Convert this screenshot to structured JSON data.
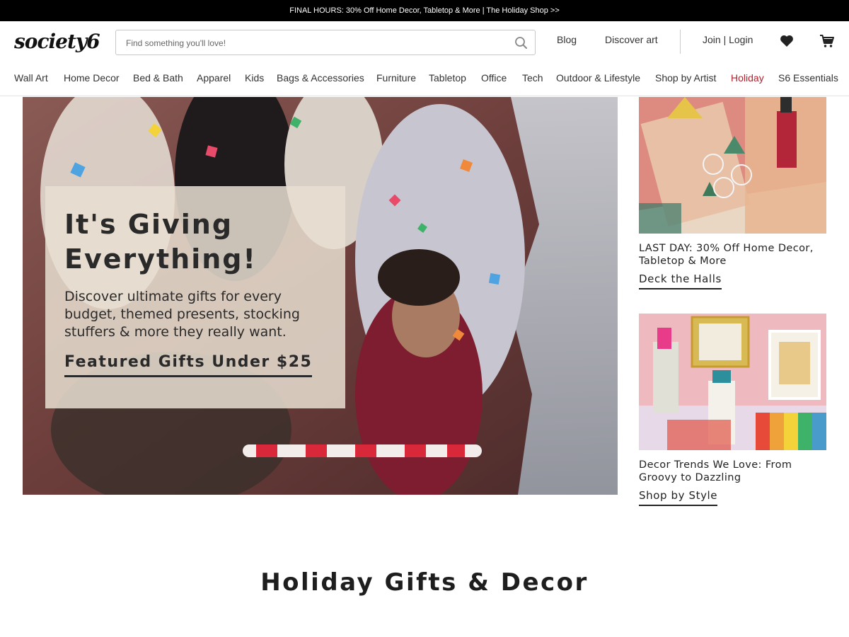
{
  "promo_bar": {
    "text": "FINAL HOURS: 30% Off Home Decor, Tabletop & More | The Holiday Shop >>"
  },
  "header": {
    "logo": "society6",
    "search": {
      "placeholder": "Find something you'll love!",
      "value": ""
    },
    "blog_label": "Blog",
    "discover_label": "Discover art",
    "join_login_label": "Join | Login",
    "icons": [
      "search-icon",
      "heart-icon",
      "cart-icon"
    ]
  },
  "nav": {
    "items": [
      {
        "label": "Wall Art"
      },
      {
        "label": "Home Decor"
      },
      {
        "label": "Bed & Bath"
      },
      {
        "label": "Apparel"
      },
      {
        "label": "Kids"
      },
      {
        "label": "Bags & Accessories"
      },
      {
        "label": "Furniture"
      },
      {
        "label": "Tabletop"
      },
      {
        "label": "Office"
      },
      {
        "label": "Tech"
      },
      {
        "label": "Outdoor & Lifestyle"
      },
      {
        "label": "Shop by Artist"
      },
      {
        "label": "Holiday"
      },
      {
        "label": "S6 Essentials"
      }
    ],
    "active": "Holiday",
    "active_color": "#b21f2d"
  },
  "hero": {
    "title": "It's Giving Everything!",
    "subtitle": "Discover ultimate gifts for every budget, themed presents, stocking stuffers & more they really want.",
    "cta_label": "Featured Gifts Under $25"
  },
  "side_promos": [
    {
      "title": "LAST DAY: 30% Off Home Decor, Tabletop & More",
      "link_label": "Deck the Halls"
    },
    {
      "title": "Decor Trends We Love: From Groovy to Dazzling",
      "link_label": "Shop by Style"
    }
  ],
  "section": {
    "title": "Holiday Gifts & Decor"
  }
}
